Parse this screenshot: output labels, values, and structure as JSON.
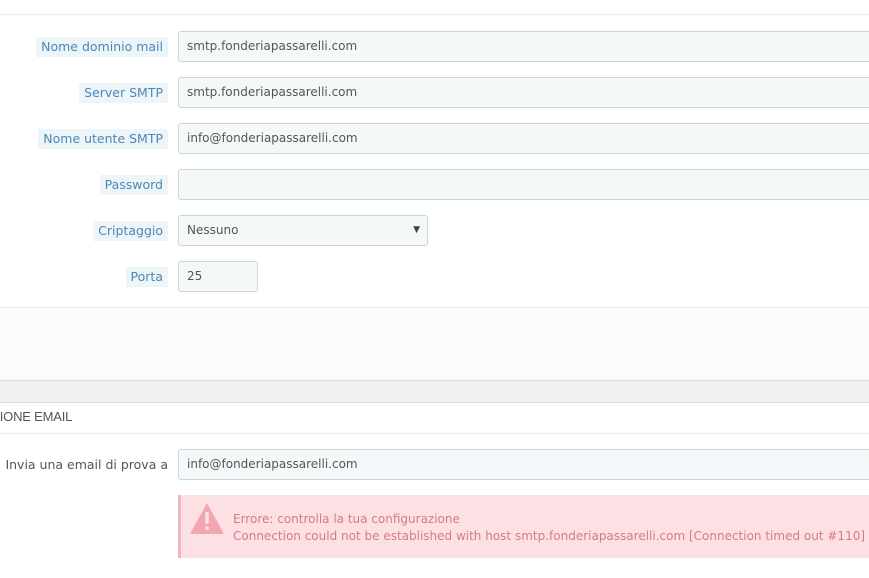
{
  "smtp_settings": {
    "mail_domain": {
      "label": "Nome dominio mail",
      "value": "smtp.fonderiapassarelli.com"
    },
    "smtp_server": {
      "label": "Server SMTP",
      "value": "smtp.fonderiapassarelli.com"
    },
    "smtp_user": {
      "label": "Nome utente SMTP",
      "value": "info@fonderiapassarelli.com"
    },
    "password": {
      "label": "Password",
      "value": ""
    },
    "encryption": {
      "label": "Criptaggio",
      "selected": "Nessuno"
    },
    "port": {
      "label": "Porta",
      "value": "25"
    }
  },
  "test_section": {
    "title": "ZIONE EMAIL",
    "send_test": {
      "label": "Invia una email di prova a",
      "value": "info@fonderiapassarelli.com"
    }
  },
  "alert": {
    "line1": "Errore: controlla la tua configurazione",
    "line2": "Connection could not be established with host smtp.fonderiapassarelli.com [Connection timed out #110]",
    "icon": "warning-triangle-icon",
    "color": "#d67b85"
  }
}
